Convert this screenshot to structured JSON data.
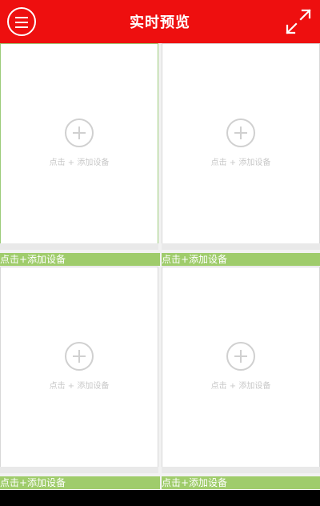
{
  "header": {
    "title": "实时预览",
    "menu_icon": "menu-icon",
    "fullscreen_icon": "fullscreen-icon"
  },
  "cells": [
    {
      "hint": "点击 + 添加设备",
      "label": "点击+添加设备"
    },
    {
      "hint": "点击 + 添加设备",
      "label": "点击+添加设备"
    },
    {
      "hint": "点击 + 添加设备",
      "label": "点击+添加设备"
    },
    {
      "hint": "点击 + 添加设备",
      "label": "点击+添加设备"
    }
  ],
  "colors": {
    "header": "#ee0f0f",
    "label_bar": "#9fcc6b"
  }
}
